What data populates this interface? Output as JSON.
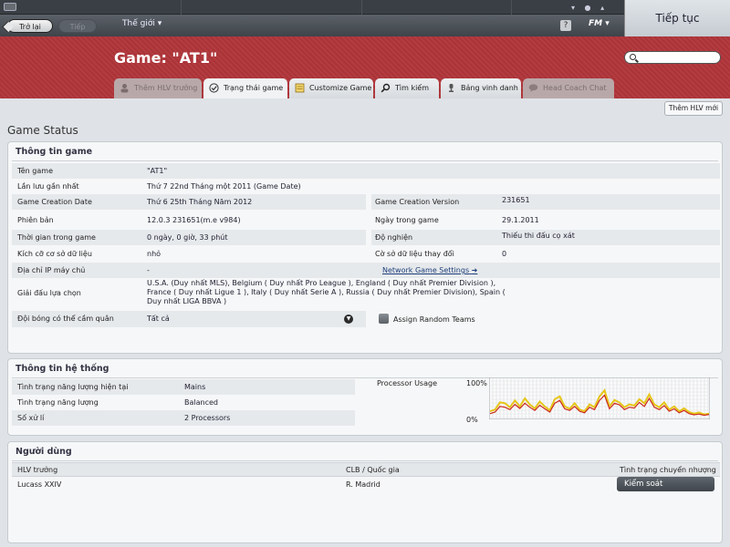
{
  "nav": {
    "back_label": "Trở lại",
    "forward_label": "Tiếp",
    "world_menu_label": "Thế giới",
    "help_label": "?",
    "fm_label": "FM",
    "continue_label": "Tiếp tục"
  },
  "header": {
    "title": "Game: \"AT1\"",
    "search_placeholder": ""
  },
  "tabs": [
    {
      "label": "Thêm HLV trưởng",
      "icon": "person-icon"
    },
    {
      "label": "Trạng thái game",
      "icon": "check-icon"
    },
    {
      "label": "Customize Game",
      "icon": "notepad-icon"
    },
    {
      "label": "Tìm kiếm",
      "icon": "search-icon"
    },
    {
      "label": "Bảng vinh danh",
      "icon": "trophy-icon"
    },
    {
      "label": "Head Coach Chat",
      "icon": "chat-icon"
    }
  ],
  "add_coach_button": "Thêm HLV mới",
  "page_heading": "Game Status",
  "game_info": {
    "title": "Thông tin game",
    "rows": {
      "name": {
        "label": "Tên game",
        "value": "\"AT1\""
      },
      "last_save": {
        "label": "Lần lưu gần nhất",
        "value": "Thứ 7 22nd Tháng một 2011 (Game Date)"
      },
      "creation_date": {
        "label": "Game Creation Date",
        "value": "Thứ 6 25th Tháng Năm 2012"
      },
      "creation_version": {
        "label": "Game Creation Version",
        "value": "231651"
      },
      "version": {
        "label": "Phiên bản",
        "value": "12.0.3 231651(m.e v984)"
      },
      "game_day": {
        "label": "Ngày trong game",
        "value": "29.1.2011"
      },
      "play_time": {
        "label": "Thời gian trong game",
        "value": "0 ngày, 0 giờ, 33 phút"
      },
      "addiction": {
        "label": "Độ nghiện",
        "value": "Thiếu thi đấu cọ xát"
      },
      "db_size": {
        "label": "Kích cỡ cơ sở dữ liệu",
        "value": "nhỏ"
      },
      "db_changes": {
        "label": "Cờ sở dữ liệu thay đổi",
        "value": "0"
      },
      "server_ip": {
        "label": "Địa chỉ IP máy chủ",
        "value": "-"
      },
      "network_link": "Network Game Settings",
      "leagues": {
        "label": "Giải đấu lựa chọn",
        "value": "U.S.A. (Duy nhất MLS), Belgium ( Duy nhất Pro League ), England ( Duy nhất Premier Division ), France ( Duy nhất Ligue 1 ), Italy ( Duy nhất Serie A ), Russia ( Duy nhất Premier Division), Spain ( Duy nhất LIGA BBVA )"
      },
      "teams": {
        "label": "Đội bóng có thể cầm quân",
        "value": "Tất cả"
      },
      "random_teams_label": "Assign Random Teams"
    }
  },
  "system_info": {
    "title": "Thông tin hệ thống",
    "rows": [
      {
        "label": "Tình trạng năng lượng hiện tại",
        "value": "Mains"
      },
      {
        "label": "Tình trạng năng lượng",
        "value": "Balanced"
      },
      {
        "label": "Số xử lí",
        "value": "2 Processors"
      }
    ],
    "processor_label": "Processor Usage",
    "axis_max": "100%",
    "axis_min": "0%"
  },
  "chart_data": {
    "type": "line",
    "title": "Processor Usage",
    "ylim": [
      0,
      100
    ],
    "ylabel": "",
    "xlabel": "",
    "series": [
      {
        "color": "#e6c619",
        "values": [
          18,
          22,
          40,
          38,
          28,
          45,
          30,
          50,
          35,
          25,
          42,
          30,
          20,
          48,
          55,
          30,
          24,
          38,
          22,
          18,
          35,
          28,
          55,
          70,
          30,
          46,
          40,
          28,
          35,
          32,
          48,
          38,
          60,
          35,
          28,
          40,
          22,
          30,
          18,
          25,
          16,
          12,
          15,
          10,
          12
        ]
      },
      {
        "color": "#cc2a1e",
        "values": [
          12,
          16,
          30,
          28,
          22,
          35,
          25,
          38,
          28,
          20,
          33,
          24,
          16,
          38,
          45,
          24,
          20,
          30,
          18,
          14,
          28,
          22,
          45,
          58,
          24,
          38,
          34,
          22,
          28,
          26,
          40,
          30,
          50,
          28,
          22,
          32,
          18,
          24,
          14,
          20,
          12,
          9,
          11,
          8,
          10
        ]
      }
    ]
  },
  "users": {
    "title": "Người dùng",
    "headers": [
      "HLV trưởng",
      "CLB / Quốc gia",
      "Tình trạng chuyển nhượng"
    ],
    "rows": [
      {
        "coach": "Lucass XXIV",
        "club": "R. Madrid",
        "status": "Kiểm soát"
      }
    ]
  }
}
